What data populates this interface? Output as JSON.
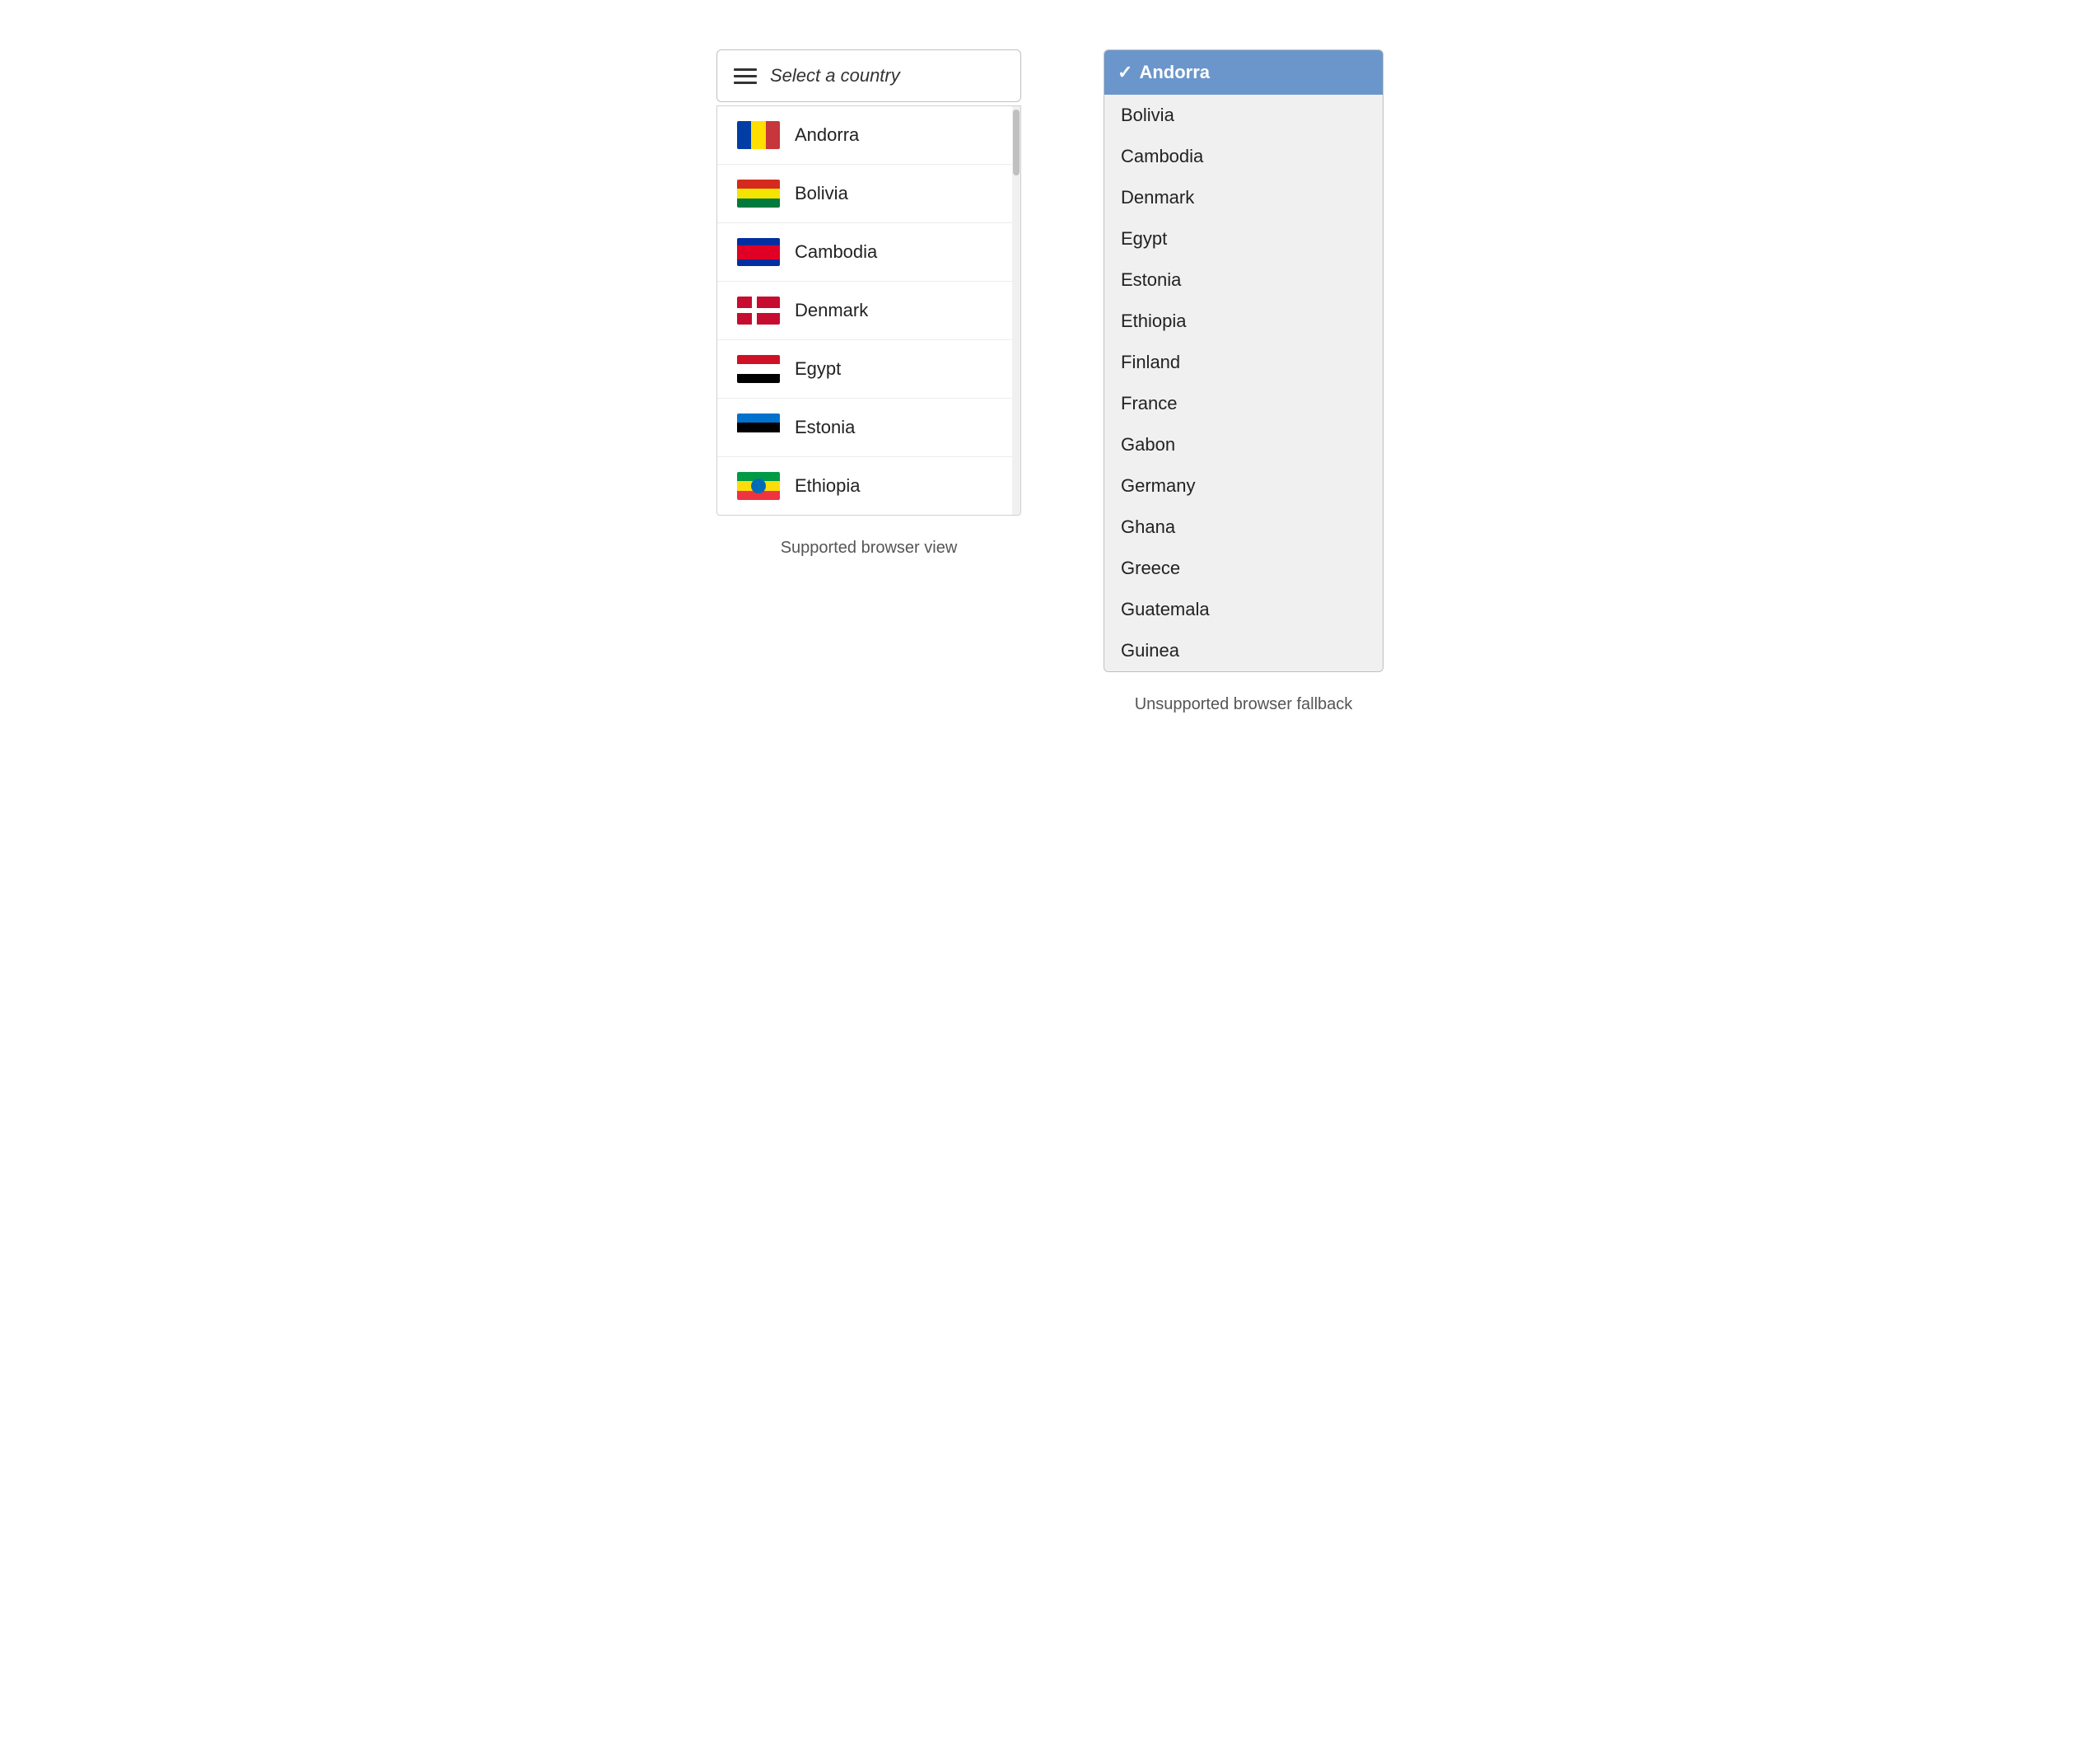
{
  "left": {
    "trigger_label": "Select a country",
    "countries": [
      {
        "name": "Andorra",
        "flag": "andorra"
      },
      {
        "name": "Bolivia",
        "flag": "bolivia"
      },
      {
        "name": "Cambodia",
        "flag": "cambodia"
      },
      {
        "name": "Denmark",
        "flag": "denmark"
      },
      {
        "name": "Egypt",
        "flag": "egypt"
      },
      {
        "name": "Estonia",
        "flag": "estonia"
      },
      {
        "name": "Ethiopia",
        "flag": "ethiopia"
      }
    ],
    "label": "Supported browser view"
  },
  "right": {
    "selected": "Andorra",
    "options": [
      "Bolivia",
      "Cambodia",
      "Denmark",
      "Egypt",
      "Estonia",
      "Ethiopia",
      "Finland",
      "France",
      "Gabon",
      "Germany",
      "Ghana",
      "Greece",
      "Guatemala",
      "Guinea"
    ],
    "label": "Unsupported browser fallback"
  }
}
